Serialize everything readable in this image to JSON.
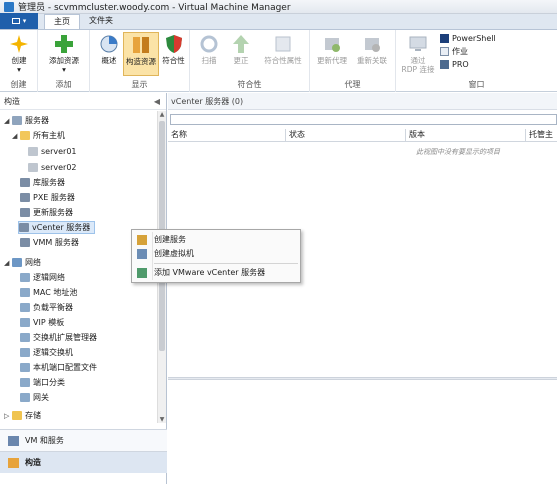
{
  "window": {
    "title": "管理员 - scvmmcluster.woody.com - Virtual Machine Manager"
  },
  "ribbon": {
    "tabs": [
      {
        "label": "主页"
      },
      {
        "label": "文件夹"
      }
    ],
    "groups": [
      {
        "label": "创建"
      },
      {
        "label": "添加"
      },
      {
        "label": "显示"
      },
      {
        "label": "符合性"
      },
      {
        "label": "代理"
      },
      {
        "label": "窗口"
      }
    ],
    "buttons": {
      "create": "创建",
      "add_resources": "添加资源",
      "overview": "概述",
      "fabric_resources": "构造资源",
      "compliance": "符合性",
      "scan": "扫描",
      "remediate": "更正",
      "compliance_props": "符合性属性",
      "refresh_agent": "更新代理",
      "reassociate": "重新关联",
      "rdp_line1": "通过",
      "rdp_line2": "RDP 连接"
    },
    "small": {
      "powershell": "PowerShell",
      "jobs": "作业",
      "pro": "PRO"
    }
  },
  "nav": {
    "header": "构造",
    "collapse": "◀",
    "tree": {
      "servers": "服务器",
      "all_hosts": "所有主机",
      "server01": "server01",
      "server02": "server02",
      "library": "库服务器",
      "pxe": "PXE 服务器",
      "update": "更新服务器",
      "vcenter": "vCenter 服务器",
      "vmm": "VMM 服务器",
      "network": "网络",
      "logical_net": "逻辑网络",
      "mac_pool": "MAC 地址池",
      "lb": "负载平衡器",
      "vip": "VIP 模板",
      "switch_ext": "交换机扩展管理器",
      "logical_switch": "逻辑交换机",
      "port_profile": "本机端口配置文件",
      "port_class": "端口分类",
      "gateway": "网关",
      "storage": "存储"
    },
    "workspaces": {
      "vms": "VM 和服务",
      "fabric": "构造"
    }
  },
  "main": {
    "title": "vCenter 服务器 (0)",
    "columns": [
      "名称",
      "状态",
      "版本",
      "托管主"
    ],
    "empty_text": "此视图中没有要显示的项目"
  },
  "context_menu": {
    "create_service": "创建服务",
    "create_vm": "创建虚拟机",
    "add_vcenter": "添加 VMware vCenter 服务器"
  }
}
